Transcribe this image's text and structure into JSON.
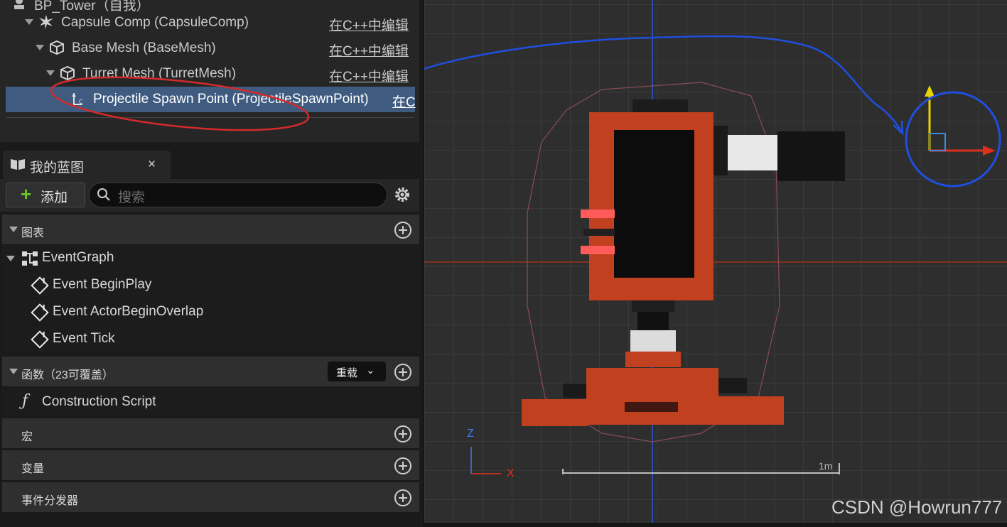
{
  "component_tree": {
    "root_label": "BP_Tower（自我）",
    "items": [
      {
        "label": "Capsule Comp (CapsuleComp)",
        "edit": "在C++中编辑"
      },
      {
        "label": "Base Mesh (BaseMesh)",
        "edit": "在C++中编辑"
      },
      {
        "label": "Turret Mesh (TurretMesh)",
        "edit": "在C++中编辑"
      },
      {
        "label": "Projectile Spawn Point (ProjectileSpawnPoint)",
        "edit": "在C"
      }
    ]
  },
  "my_blueprint": {
    "tab_title": "我的蓝图",
    "close": "×",
    "add_label": "添加",
    "search_placeholder": "搜索",
    "sections": {
      "graphs": "图表",
      "functions": "函数（23可覆盖）",
      "override_label": "重载",
      "macros": "宏",
      "variables": "变量",
      "event_dispatchers": "事件分发器"
    },
    "event_graph": "EventGraph",
    "events": [
      "Event BeginPlay",
      "Event ActorBeginOverlap",
      "Event Tick"
    ],
    "construction_script": "Construction Script"
  },
  "viewport": {
    "axis_z": "Z",
    "axis_x": "X",
    "scale_label": "1m"
  },
  "watermark": "CSDN @Howrun777",
  "colors": {
    "selection": "#3f5b80",
    "annotation_red": "#d42a2a",
    "annotation_blue": "#1f4fe0",
    "turret_body": "#c0401f",
    "add_plus": "#6bc52a"
  }
}
